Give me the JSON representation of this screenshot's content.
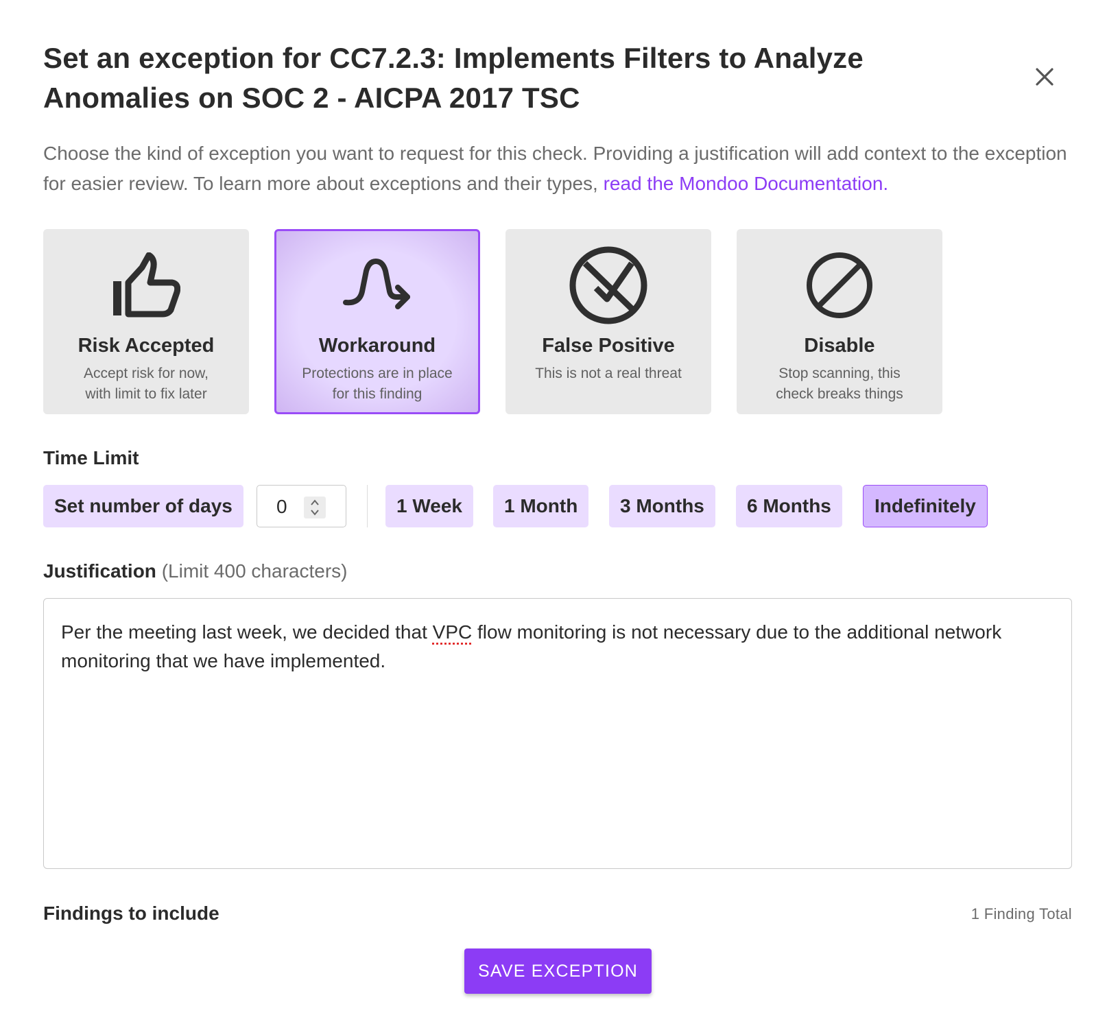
{
  "dialog": {
    "title": "Set an exception for CC7.2.3: Implements Filters to Analyze Anomalies on SOC 2 - AICPA 2017 TSC",
    "close_icon": "close-icon",
    "description_text": "Choose the kind of exception you want to request for this check. Providing a justification will add context to the exception for easier review. To learn more about exceptions and their types, ",
    "description_link": "read the Mondoo Documentation."
  },
  "exception_types": [
    {
      "title": "Risk Accepted",
      "description": "Accept risk for now,\nwith limit to fix later",
      "icon": "thumbs-up-icon",
      "selected": false
    },
    {
      "title": "Workaround",
      "description": "Protections are in place\nfor this finding",
      "icon": "workaround-arrow-icon",
      "selected": true
    },
    {
      "title": "False Positive",
      "description": "This is not a real threat",
      "icon": "circle-check-cross-icon",
      "selected": false
    },
    {
      "title": "Disable",
      "description": "Stop scanning, this\ncheck breaks things",
      "icon": "block-icon",
      "selected": false
    }
  ],
  "time_limit": {
    "label": "Time Limit",
    "set_days_label": "Set number of days",
    "days_value": "0",
    "options": [
      "1 Week",
      "1 Month",
      "3 Months",
      "6 Months",
      "Indefinitely"
    ],
    "selected": "Indefinitely"
  },
  "justification": {
    "label": "Justification",
    "limit_note": "(Limit 400 characters)",
    "text_before": "Per the meeting last week, we decided that ",
    "text_flagged": "VPC",
    "text_after": " flow monitoring is not necessary due to the additional network monitoring that we have implemented."
  },
  "findings": {
    "label": "Findings to include",
    "total": "1 Finding Total"
  },
  "save_button": "SAVE EXCEPTION",
  "colors": {
    "accent": "#8c3cf5",
    "chip_bg": "#eadcff",
    "card_bg": "#e9e9e9"
  }
}
